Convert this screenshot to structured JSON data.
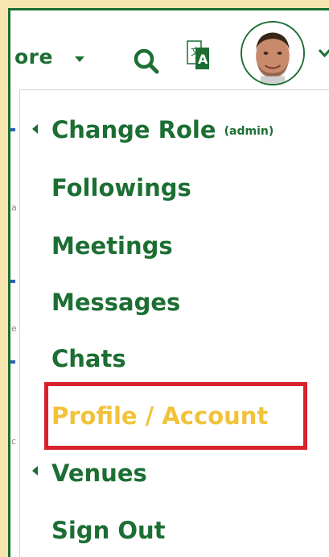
{
  "topbar": {
    "more_label": "ore",
    "icons": [
      "search-icon",
      "translate-icon",
      "caret-down-icon"
    ],
    "brand_color": "#1c6e33"
  },
  "menu": {
    "items": [
      {
        "label": "Change Role",
        "suffix": "(admin)",
        "has_submenu": true
      },
      {
        "label": "Followings"
      },
      {
        "label": "Meetings"
      },
      {
        "label": "Messages"
      },
      {
        "label": "Chats"
      },
      {
        "label": "Profile / Account",
        "active": true
      },
      {
        "label": "Venues",
        "has_submenu": true
      },
      {
        "label": "Sign Out"
      }
    ],
    "active_color": "#f2c23a",
    "highlight_color": "#d9232b"
  }
}
